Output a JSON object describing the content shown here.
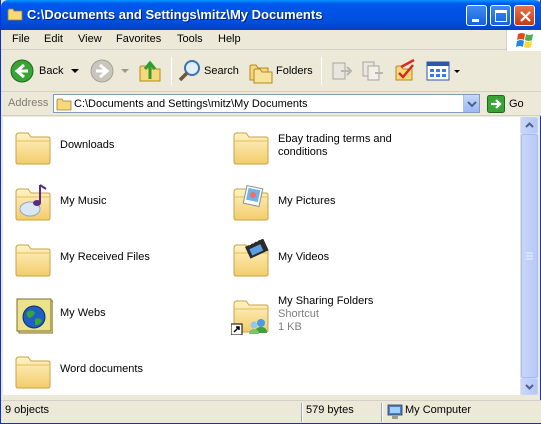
{
  "window": {
    "title": "C:\\Documents and Settings\\mitz\\My Documents",
    "controls": {
      "minimize": "minimize",
      "maximize": "maximize",
      "close": "close"
    }
  },
  "menubar": {
    "items": [
      {
        "label": "File"
      },
      {
        "label": "Edit"
      },
      {
        "label": "View"
      },
      {
        "label": "Favorites"
      },
      {
        "label": "Tools"
      },
      {
        "label": "Help"
      }
    ]
  },
  "toolbar": {
    "back_label": "Back",
    "search_label": "Search",
    "folders_label": "Folders",
    "icons": [
      "back-icon",
      "forward-icon",
      "up-folder-icon",
      "search-icon",
      "folders-icon",
      "move-to-icon",
      "copy-to-icon",
      "undo-icon",
      "views-icon"
    ]
  },
  "address": {
    "label": "Address",
    "value": "C:\\Documents and Settings\\mitz\\My Documents",
    "go_label": "Go"
  },
  "items": [
    {
      "name": "Downloads",
      "icon": "folder-icon"
    },
    {
      "name": "Ebay trading terms and",
      "name2": "conditions",
      "icon": "folder-icon"
    },
    {
      "name": "My Music",
      "icon": "music-folder-icon"
    },
    {
      "name": "My Pictures",
      "icon": "pictures-folder-icon"
    },
    {
      "name": "My Received Files",
      "icon": "folder-icon"
    },
    {
      "name": "My Videos",
      "icon": "videos-folder-icon"
    },
    {
      "name": "My Webs",
      "icon": "webs-folder-icon"
    },
    {
      "name": "My Sharing Folders",
      "type": "Shortcut",
      "size": "1 KB",
      "icon": "shortcut-folder-icon"
    },
    {
      "name": "Word documents",
      "icon": "folder-icon"
    }
  ],
  "status": {
    "objects": "9 objects",
    "size": "579 bytes",
    "location": "My Computer"
  },
  "colors": {
    "titlebar": "#0053e6",
    "folder": "#f5d97a",
    "window_bg": "#ece9d8"
  }
}
